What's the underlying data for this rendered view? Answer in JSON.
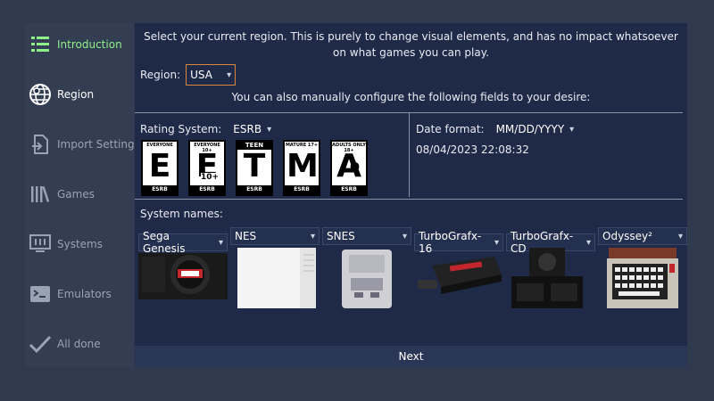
{
  "sidebar": {
    "items": [
      {
        "label": "Introduction",
        "icon": "list-icon"
      },
      {
        "label": "Region",
        "icon": "globe-icon"
      },
      {
        "label": "Import Settings",
        "icon": "import-icon"
      },
      {
        "label": "Games",
        "icon": "library-icon"
      },
      {
        "label": "Systems",
        "icon": "monitor-icon"
      },
      {
        "label": "Emulators",
        "icon": "terminal-icon"
      },
      {
        "label": "All done",
        "icon": "check-icon"
      }
    ]
  },
  "main": {
    "intro_text": "Select your current region. This is purely to change visual elements, and has no impact whatsoever on what games you can play.",
    "region_label": "Region:",
    "region_value": "USA",
    "manual_text": "You can also manually configure the following fields to your desire:",
    "rating_label": "Rating System:",
    "rating_value": "ESRB",
    "ratings": [
      {
        "top": "EVERYONE",
        "letter": "E",
        "bottom": "ESRB"
      },
      {
        "top": "EVERYONE 10+",
        "letter": "E",
        "bottom": "ESRB",
        "extra": "10+"
      },
      {
        "top": "TEEN",
        "letter": "T",
        "bottom": "ESRB"
      },
      {
        "top": "MATURE 17+",
        "letter": "M",
        "bottom": "ESRB"
      },
      {
        "top": "ADULTS ONLY 18+",
        "letter": "A",
        "bottom": "ESRB",
        "extra": "O"
      }
    ],
    "date_label": "Date format:",
    "date_value": "MM/DD/YYYY",
    "datetime": "08/04/2023 22:08:32",
    "system_names_label": "System names:",
    "systems": [
      {
        "name": "Sega Genesis"
      },
      {
        "name": "NES"
      },
      {
        "name": "SNES"
      },
      {
        "name": "TurboGrafx-16"
      },
      {
        "name": "TurboGrafx-CD"
      },
      {
        "name": "Odyssey²"
      }
    ],
    "next_label": "Next"
  },
  "colors": {
    "background": "#2f3a4e",
    "sidebar": "#333e52",
    "panel": "#1f2a48",
    "active_accent": "#8ff08a",
    "dropdown_focus": "#d9853b"
  }
}
